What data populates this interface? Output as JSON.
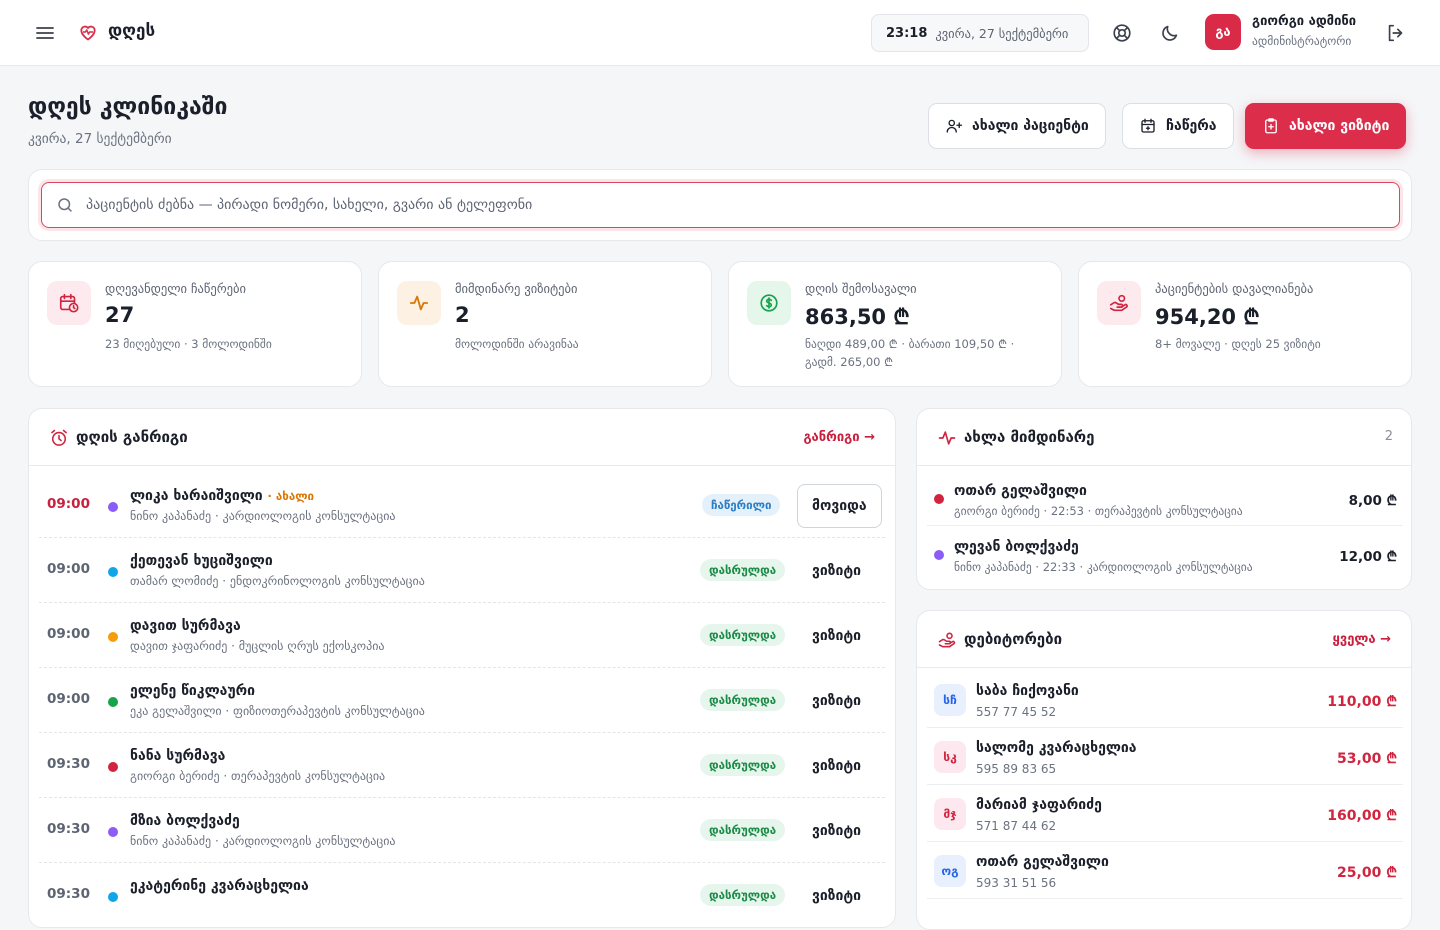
{
  "topbar": {
    "brand": "დღეს",
    "time": "23:18",
    "date": "კვირა, 27 სექტემბერი",
    "user": {
      "initials": "გა",
      "name": "გიორგი ადმინი",
      "role": "ადმინისტრატორი"
    }
  },
  "header": {
    "title": "დღეს კლინიკაში",
    "date": "კვირა, 27 სექტემბერი",
    "buttons": {
      "new_patient": "ახალი პაციენტი",
      "appointment": "ჩაწერა",
      "new_visit": "ახალი ვიზიტი"
    }
  },
  "search": {
    "placeholder": "პაციენტის ძებნა — პირადი ნომერი, სახელი, გვარი ან ტელეფონი"
  },
  "stats": [
    {
      "label": "დღევანდელი ჩაწერები",
      "value": "27",
      "sub": "23 მიღებული · 3 მოლოდინში",
      "icon": "calendar-clock-icon",
      "color": "#d0243f"
    },
    {
      "label": "მიმდინარე ვიზიტები",
      "value": "2",
      "sub": "მოლოდინში არავინაა",
      "icon": "activity-icon",
      "color": "#d97706"
    },
    {
      "label": "დღის შემოსავალი",
      "value": "863,50 ₾",
      "sub": "ნაღდი 489,00 ₾ · ბარათი 109,50 ₾ · გადმ. 265,00 ₾",
      "icon": "dollar-circle-icon",
      "color": "#16a34a"
    },
    {
      "label": "პაციენტების დავალიანება",
      "value": "954,20 ₾",
      "sub": "8+ მოვალე · დღეს 25 ვიზიტი",
      "icon": "hand-coins-icon",
      "color": "#d0243f"
    }
  ],
  "schedule": {
    "title": "დღის განრიგი",
    "link": "განრიგი →",
    "rows": [
      {
        "time": "09:00",
        "name": "ლიკა ხარაიშვილი",
        "new_tag": "· ახალი",
        "meta": "ნინო კაპანაძე · კარდიოლოგის კონსულტაცია",
        "status": "ჩაწერილი",
        "action": "მოვიდა",
        "dot": "#8b5cf6"
      },
      {
        "time": "09:00",
        "name": "ქეთევან ხუციშვილი",
        "new_tag": "",
        "meta": "თამარ ლომიძე · ენდოკრინოლოგის კონსულტაცია",
        "status": "დასრულდა",
        "action": "ვიზიტი",
        "dot": "#0ea5e9"
      },
      {
        "time": "09:00",
        "name": "დავით სურმავა",
        "new_tag": "",
        "meta": "დავით ჯაფარიძე · მუცლის ღრუს ექოსკოპია",
        "status": "დასრულდა",
        "action": "ვიზიტი",
        "dot": "#f59e0b"
      },
      {
        "time": "09:00",
        "name": "ელენე წიკლაური",
        "new_tag": "",
        "meta": "ეკა გელაშვილი · ფიზიოთერაპევტის კონსულტაცია",
        "status": "დასრულდა",
        "action": "ვიზიტი",
        "dot": "#16a34a"
      },
      {
        "time": "09:30",
        "name": "ნანა სურმავა",
        "new_tag": "",
        "meta": "გიორგი ბერიძე · თერაპევტის კონსულტაცია",
        "status": "დასრულდა",
        "action": "ვიზიტი",
        "dot": "#d0243f"
      },
      {
        "time": "09:30",
        "name": "მზია ბოლქვაძე",
        "new_tag": "",
        "meta": "ნინო კაპანაძე · კარდიოლოგის კონსულტაცია",
        "status": "დასრულდა",
        "action": "ვიზიტი",
        "dot": "#8b5cf6"
      },
      {
        "time": "09:30",
        "name": "ეკატერინე კვარაცხელია",
        "new_tag": "",
        "meta": "",
        "status": "დასრულდა",
        "action": "ვიზიტი",
        "dot": "#0ea5e9"
      }
    ]
  },
  "current": {
    "title": "ახლა მიმდინარე",
    "count": "2",
    "rows": [
      {
        "name": "ოთარ გელაშვილი",
        "meta": "გიორგი ბერიძე · 22:53 · თერაპევტის კონსულტაცია",
        "amount": "8,00 ₾",
        "dot": "#d0243f"
      },
      {
        "name": "ლევან ბოლქვაძე",
        "meta": "ნინო კაპანაძე · 22:33 · კარდიოლოგის კონსულტაცია",
        "amount": "12,00 ₾",
        "dot": "#8b5cf6"
      }
    ]
  },
  "debtors": {
    "title": "დებიტორები",
    "link": "ყველა →",
    "rows": [
      {
        "initials": "სჩ",
        "name": "საბა ჩიქოვანი",
        "phone": "557 77 45 52",
        "amount": "110,00 ₾",
        "bg": "#e8f0fd",
        "fg": "#2563eb"
      },
      {
        "initials": "სკ",
        "name": "სალომე კვარაცხელია",
        "phone": "595 89 83 65",
        "amount": "53,00 ₾",
        "bg": "#fde8ef",
        "fg": "#d0243f"
      },
      {
        "initials": "მჯ",
        "name": "მარიამ ჯაფარიძე",
        "phone": "571 87 44 62",
        "amount": "160,00 ₾",
        "bg": "#fde8ef",
        "fg": "#d0243f"
      },
      {
        "initials": "ოგ",
        "name": "ოთარ გელაშვილი",
        "phone": "593 31 51 56",
        "amount": "25,00 ₾",
        "bg": "#e8f0fd",
        "fg": "#2563eb"
      }
    ]
  }
}
